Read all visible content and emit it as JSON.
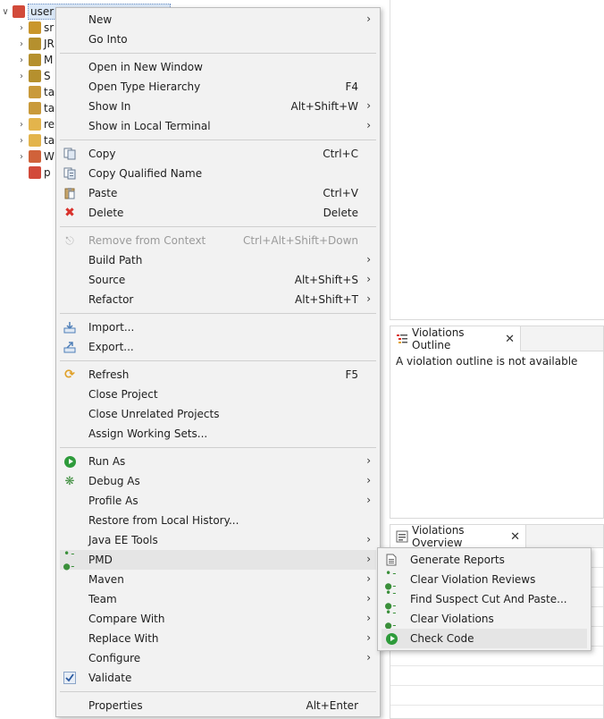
{
  "tree": {
    "root_label": "user",
    "items": [
      "sr",
      "JR",
      "M",
      "S",
      "ta",
      "ta",
      "re",
      "ta",
      "W",
      "p"
    ]
  },
  "violations_outline": {
    "tab_label": "Violations Outline",
    "empty_text": "A violation outline is not available"
  },
  "violations_overview": {
    "tab_label": "Violations Overview"
  },
  "context_menu": {
    "new": "New",
    "go_into": "Go Into",
    "open_new_window": "Open in New Window",
    "open_type_hierarchy": "Open Type Hierarchy",
    "open_type_hierarchy_accel": "F4",
    "show_in": "Show In",
    "show_in_accel": "Alt+Shift+W",
    "show_local_terminal": "Show in Local Terminal",
    "copy": "Copy",
    "copy_accel": "Ctrl+C",
    "copy_qualified": "Copy Qualified Name",
    "paste": "Paste",
    "paste_accel": "Ctrl+V",
    "delete": "Delete",
    "delete_accel": "Delete",
    "remove_context": "Remove from Context",
    "remove_context_accel": "Ctrl+Alt+Shift+Down",
    "build_path": "Build Path",
    "source": "Source",
    "source_accel": "Alt+Shift+S",
    "refactor": "Refactor",
    "refactor_accel": "Alt+Shift+T",
    "import": "Import...",
    "export": "Export...",
    "refresh": "Refresh",
    "refresh_accel": "F5",
    "close_project": "Close Project",
    "close_unrelated": "Close Unrelated Projects",
    "assign_working_sets": "Assign Working Sets...",
    "run_as": "Run As",
    "debug_as": "Debug As",
    "profile_as": "Profile As",
    "restore_history": "Restore from Local History...",
    "java_ee_tools": "Java EE Tools",
    "pmd": "PMD",
    "maven": "Maven",
    "team": "Team",
    "compare_with": "Compare With",
    "replace_with": "Replace With",
    "configure": "Configure",
    "validate": "Validate",
    "properties": "Properties",
    "properties_accel": "Alt+Enter"
  },
  "pmd_submenu": {
    "generate_reports": "Generate Reports",
    "clear_violation_reviews": "Clear Violation Reviews",
    "find_suspect_cut_paste": "Find Suspect Cut And Paste...",
    "clear_violations": "Clear Violations",
    "check_code": "Check Code"
  },
  "colors": {
    "menu_bg": "#f2f2f2",
    "menu_hover": "#e5e5e5",
    "delete_red": "#d9312b",
    "run_green": "#2e9b3b",
    "pmd_green": "#3a8f3a"
  }
}
